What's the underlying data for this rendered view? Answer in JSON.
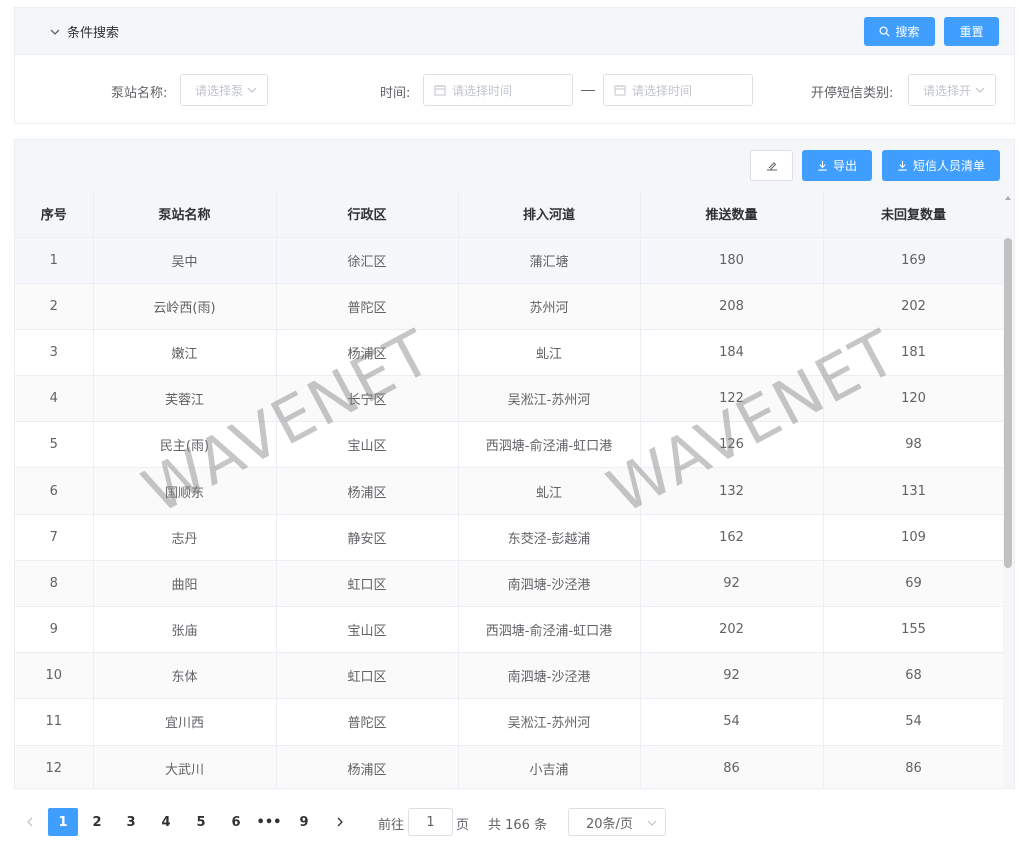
{
  "search": {
    "title": "条件搜索",
    "search_button": "搜索",
    "reset_button": "重置",
    "fields": {
      "station_label": "泵站名称:",
      "station_placeholder": "请选择泵",
      "time_label": "时间:",
      "start_placeholder": "请选择时间",
      "end_placeholder": "请选择时间",
      "sms_type_label": "开停短信类别:",
      "sms_type_placeholder": "请选择开"
    }
  },
  "toolbar": {
    "export_label": "导出",
    "sms_list_label": "短信人员清单"
  },
  "table": {
    "columns": [
      "序号",
      "泵站名称",
      "行政区",
      "排入河道",
      "推送数量",
      "未回复数量"
    ],
    "rows": [
      [
        "1",
        "吴中",
        "徐汇区",
        "蒲汇塘",
        "180",
        "169"
      ],
      [
        "2",
        "云岭西(雨)",
        "普陀区",
        "苏州河",
        "208",
        "202"
      ],
      [
        "3",
        "嫩江",
        "杨浦区",
        "虬江",
        "184",
        "181"
      ],
      [
        "4",
        "芙蓉江",
        "长宁区",
        "吴淞江-苏州河",
        "122",
        "120"
      ],
      [
        "5",
        "民主(雨)",
        "宝山区",
        "西泗塘-俞泾浦-虹口港",
        "126",
        "98"
      ],
      [
        "6",
        "国顺东",
        "杨浦区",
        "虬江",
        "132",
        "131"
      ],
      [
        "7",
        "志丹",
        "静安区",
        "东茭泾-彭越浦",
        "162",
        "109"
      ],
      [
        "8",
        "曲阳",
        "虹口区",
        "南泗塘-沙泾港",
        "92",
        "69"
      ],
      [
        "9",
        "张庙",
        "宝山区",
        "西泗塘-俞泾浦-虹口港",
        "202",
        "155"
      ],
      [
        "10",
        "东体",
        "虹口区",
        "南泗塘-沙泾港",
        "92",
        "68"
      ],
      [
        "11",
        "宜川西",
        "普陀区",
        "吴淞江-苏州河",
        "54",
        "54"
      ],
      [
        "12",
        "大武川",
        "杨浦区",
        "小吉浦",
        "86",
        "86"
      ]
    ]
  },
  "watermark": "WAVENET",
  "pagination": {
    "pages": [
      "1",
      "2",
      "3",
      "4",
      "5",
      "6",
      "•••",
      "9"
    ],
    "current": "1",
    "goto_prefix": "前往",
    "goto_value": "1",
    "goto_suffix": "页",
    "total": "共 166 条",
    "page_size": "20条/页"
  },
  "colors": {
    "primary": "#409eff",
    "header_bg": "#f5f6f8",
    "border": "#ebeef5"
  }
}
